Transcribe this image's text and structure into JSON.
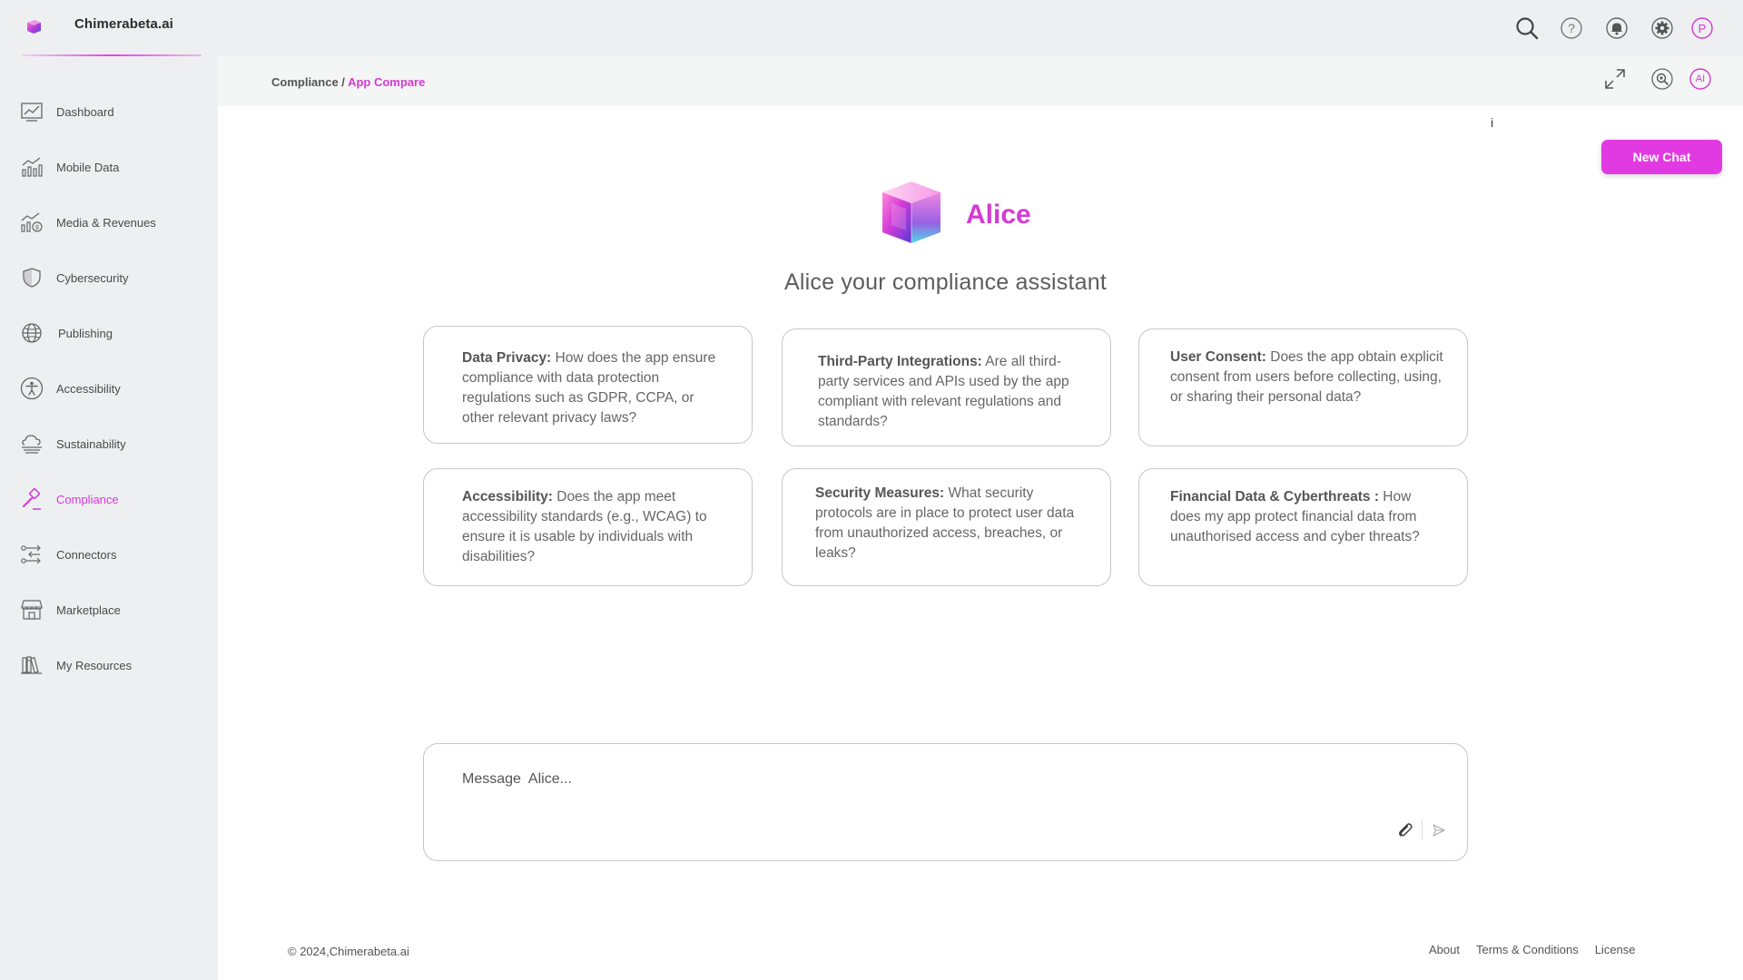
{
  "app": {
    "title": "Chimerabeta.ai",
    "accent": "#e23ae2"
  },
  "topbar": {
    "icons": [
      "search-icon",
      "help-icon",
      "bell-icon",
      "settings-icon",
      "profile-avatar-icon"
    ],
    "avatar_letter": "P"
  },
  "sidebar": {
    "items": [
      {
        "label": "Dashboard",
        "icon": "dashboard-icon"
      },
      {
        "label": "Mobile Data",
        "icon": "mobile-data-icon"
      },
      {
        "label": "Media & Revenues",
        "icon": "media-revenues-icon"
      },
      {
        "label": "Cybersecurity",
        "icon": "shield-icon"
      },
      {
        "label": "Publishing",
        "icon": "globe-icon"
      },
      {
        "label": "Accessibility",
        "icon": "accessibility-icon"
      },
      {
        "label": "Sustainability",
        "icon": "cloud-icon"
      },
      {
        "label": "Compliance",
        "icon": "gavel-icon",
        "active": true
      },
      {
        "label": "Connectors",
        "icon": "connectors-icon"
      },
      {
        "label": "Marketplace",
        "icon": "store-icon"
      },
      {
        "label": "My Resources",
        "icon": "books-icon"
      }
    ]
  },
  "breadcrumb": {
    "parent": "Compliance /",
    "current": "App Compare"
  },
  "crumb_icons": {
    "items": [
      "expand-icon",
      "zoom-icon",
      "ai-icon"
    ],
    "ai_label": "AI"
  },
  "main": {
    "info": "i",
    "new_chat": "New Chat",
    "assistant_name": "Alice",
    "subtitle": "Alice your compliance assistant",
    "cards": [
      {
        "title": "Data Privacy:",
        "text": " How does the app ensure compliance with data protection regulations such as GDPR, CCPA, or other relevant privacy laws?"
      },
      {
        "title": "Third-Party Integrations:",
        "text": " Are all third-party services and APIs used by the app compliant with relevant regulations and standards?"
      },
      {
        "title": "User Consent:",
        "text": " Does the app obtain explicit consent from users before collecting, using, or sharing their personal data?"
      },
      {
        "title": "Accessibility:",
        "text": " Does the app meet accessibility standards (e.g., WCAG) to ensure it is usable by individuals with disabilities?"
      },
      {
        "title": "Security Measures:",
        "text": " What security protocols are in place to protect user data from unauthorized access, breaches, or leaks?"
      },
      {
        "title": "Financial  Data & Cyberthreats :",
        "text": " How does my app protect financial data from unauthorised access and cyber threats?"
      }
    ],
    "composer_placeholder": "Message  Alice..."
  },
  "footer": {
    "copyright": "© 2024,Chimerabeta.ai",
    "links": [
      "About",
      "Terms & Conditions",
      "License"
    ]
  }
}
